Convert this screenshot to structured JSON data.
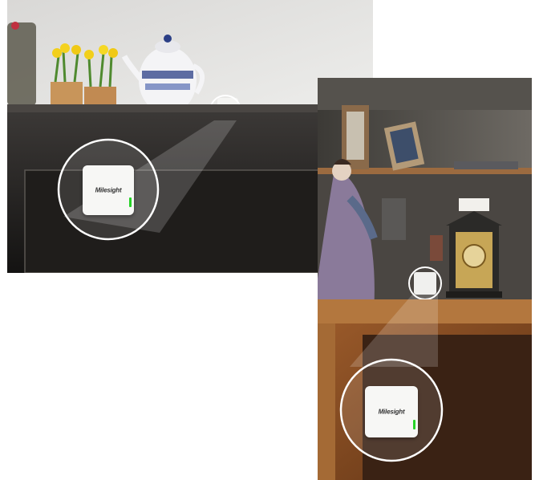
{
  "scene": {
    "left_photo": {
      "device_brand": "Milesight"
    },
    "right_photo": {
      "device_brand": "Milesight"
    }
  }
}
